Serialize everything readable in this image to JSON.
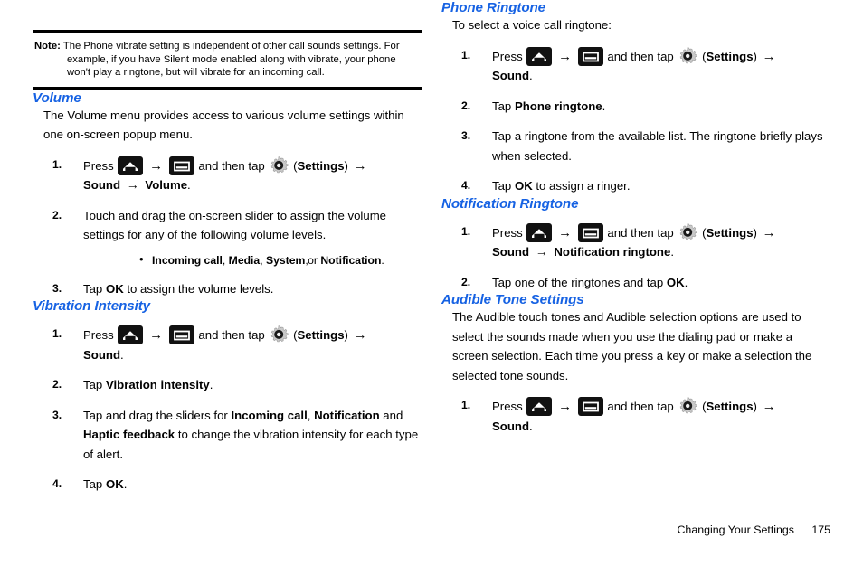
{
  "note": {
    "label": "Note:",
    "text": "The Phone vibrate setting is independent of other call sounds settings. For example, if you have Silent mode enabled along with vibrate, your phone won't play a ringtone, but will vibrate for an incoming call."
  },
  "icons": {
    "home": "home-icon",
    "menu": "menu-icon",
    "gear": "settings-gear-icon",
    "arrow": "→",
    "bullet": "•"
  },
  "common": {
    "press": "Press",
    "and_then_tap": "and then tap",
    "settings_paren_open": "(",
    "settings_label": "Settings",
    "settings_paren_close": ")",
    "tap": "Tap",
    "sound": "Sound",
    "ok": "OK",
    "period": "."
  },
  "left_column": {
    "volume": {
      "heading": "Volume",
      "intro": "The Volume menu provides access to various volume settings within one on-screen popup menu.",
      "steps": [
        {
          "num": "1.",
          "type": "press",
          "trail_bold_1": "Sound",
          "trail_bold_2": "Volume",
          "trail_end": "."
        },
        {
          "num": "2.",
          "type": "text",
          "text": "Touch and drag the on-screen slider to assign the volume settings for any of the following volume levels.",
          "bullets": [
            {
              "terms": [
                "Incoming call",
                "Media",
                "System",
                "Notification"
              ],
              "sep": ", ",
              "conj": " or ",
              "end": "."
            }
          ]
        },
        {
          "num": "3.",
          "type": "tap_ok",
          "pre": "Tap ",
          "bold": "OK",
          "post": " to assign the volume levels."
        }
      ]
    },
    "vibration": {
      "heading": "Vibration Intensity",
      "steps": [
        {
          "num": "1.",
          "type": "press",
          "trail_bold_1": "Sound",
          "trail_end": "."
        },
        {
          "num": "2.",
          "type": "tap_bold",
          "pre": "Tap ",
          "bold": "Vibration intensity",
          "post": "."
        },
        {
          "num": "3.",
          "type": "rich",
          "seg1": "Tap and drag the sliders for ",
          "bold1": "Incoming call",
          "seg2": ", ",
          "bold2": "Notification",
          "seg3": " and ",
          "bold3": "Haptic feedback",
          "seg4": " to change the vibration intensity for each type of alert."
        },
        {
          "num": "4.",
          "type": "tap_bold",
          "pre": "Tap ",
          "bold": "OK",
          "post": "."
        }
      ]
    }
  },
  "right_column": {
    "phone_ringtone": {
      "heading": "Phone Ringtone",
      "intro": "To select a voice call ringtone:",
      "steps": [
        {
          "num": "1.",
          "type": "press",
          "trail_bold_1": "Sound",
          "trail_end": "."
        },
        {
          "num": "2.",
          "type": "tap_bold",
          "pre": "Tap ",
          "bold": "Phone ringtone",
          "post": "."
        },
        {
          "num": "3.",
          "type": "text",
          "text": "Tap a ringtone from the available list. The ringtone briefly plays when selected."
        },
        {
          "num": "4.",
          "type": "tap_bold",
          "pre": "Tap ",
          "bold": "OK",
          "post": " to assign a ringer."
        }
      ]
    },
    "notification_ringtone": {
      "heading": "Notification Ringtone",
      "steps": [
        {
          "num": "1.",
          "type": "press",
          "trail_bold_1": "Sound",
          "trail_bold_2": "Notification ringtone",
          "trail_end": "."
        },
        {
          "num": "2.",
          "type": "tap_bold_mid",
          "pre": "Tap one of the ringtones and tap ",
          "bold": "OK",
          "post": "."
        }
      ]
    },
    "audible_tone": {
      "heading": "Audible Tone Settings",
      "intro": "The Audible touch tones and Audible selection options are used to select the sounds made when you use the dialing pad or make a screen selection. Each time you press a key or make a selection the selected tone sounds.",
      "steps": [
        {
          "num": "1.",
          "type": "press",
          "trail_bold_1": "Sound",
          "trail_end": "."
        }
      ]
    }
  },
  "footer": {
    "chapter": "Changing Your Settings",
    "page": "175"
  },
  "colors": {
    "heading_blue": "#1662e3",
    "icon_black": "#111111",
    "gear_grey": "#c9c9c9",
    "text_black": "#000000"
  }
}
